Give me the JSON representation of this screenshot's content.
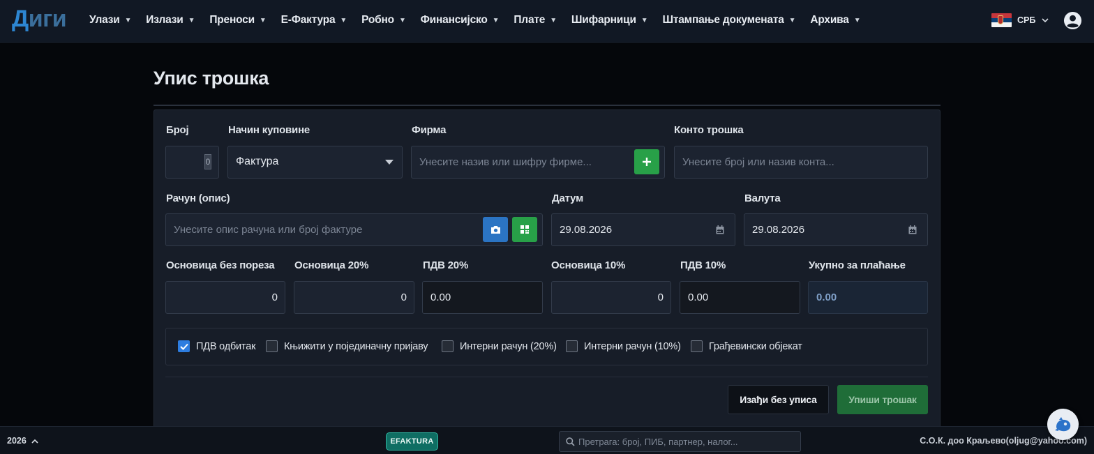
{
  "app": {
    "logo_part1": "Д",
    "logo_part2": "иги",
    "lang_label": "СРБ"
  },
  "nav": {
    "items": [
      {
        "label": "Улази"
      },
      {
        "label": "Излази"
      },
      {
        "label": "Преноси"
      },
      {
        "label": "Е-Фактура"
      },
      {
        "label": "Робно"
      },
      {
        "label": "Финансијско"
      },
      {
        "label": "Плате"
      },
      {
        "label": "Шифарници"
      },
      {
        "label": "Штампање докумената"
      },
      {
        "label": "Архива"
      }
    ]
  },
  "page": {
    "title": "Упис трошка"
  },
  "form": {
    "broj": {
      "label": "Број",
      "value": "0"
    },
    "nacin": {
      "label": "Начин куповине",
      "value": "Фактура"
    },
    "firma": {
      "label": "Фирма",
      "placeholder": "Унесите назив или шифру фирме..."
    },
    "konto": {
      "label": "Конто трошка",
      "placeholder": "Унесите број или назив конта..."
    },
    "racun": {
      "label": "Рачун (опис)",
      "placeholder": "Унесите опис рачуна или број фактуре"
    },
    "datum": {
      "label": "Датум",
      "value": "29.08.2026"
    },
    "valuta": {
      "label": "Валута",
      "value": "29.08.2026"
    },
    "osnovica_bez": {
      "label": "Основица без пореза",
      "value": "0"
    },
    "osnovica20": {
      "label": "Основица 20%",
      "value": "0"
    },
    "pdv20": {
      "label": "ПДВ 20%",
      "value": "0.00"
    },
    "osnovica10": {
      "label": "Основица 10%",
      "value": "0"
    },
    "pdv10": {
      "label": "ПДВ 10%",
      "value": "0.00"
    },
    "ukupno": {
      "label": "Укупно за плаћање",
      "value": "0.00"
    }
  },
  "checkboxes": [
    {
      "label": "ПДВ одбитак",
      "checked": true
    },
    {
      "label": "Књижити у појединачну пријаву",
      "checked": false
    },
    {
      "label": "Интерни рачун (20%)",
      "checked": false
    },
    {
      "label": "Интерни рачун (10%)",
      "checked": false
    },
    {
      "label": "Грађевински објекат",
      "checked": false
    }
  ],
  "actions": {
    "exit_label": "Изађи без уписа",
    "save_label": "Упиши трошак"
  },
  "statusbar": {
    "year": "2026",
    "efaktura_badge": "EFAKTURA",
    "search_placeholder": "Претрага: број, ПИБ, партнер, налог...",
    "company": "С.О.К. доо Краљево(oljug@yahoo.com)"
  },
  "colors": {
    "accent_blue": "#2d86d2",
    "green_button": "#28a048",
    "save_button": "#1f6d38",
    "efaktura_teal": "#0f6e63"
  }
}
